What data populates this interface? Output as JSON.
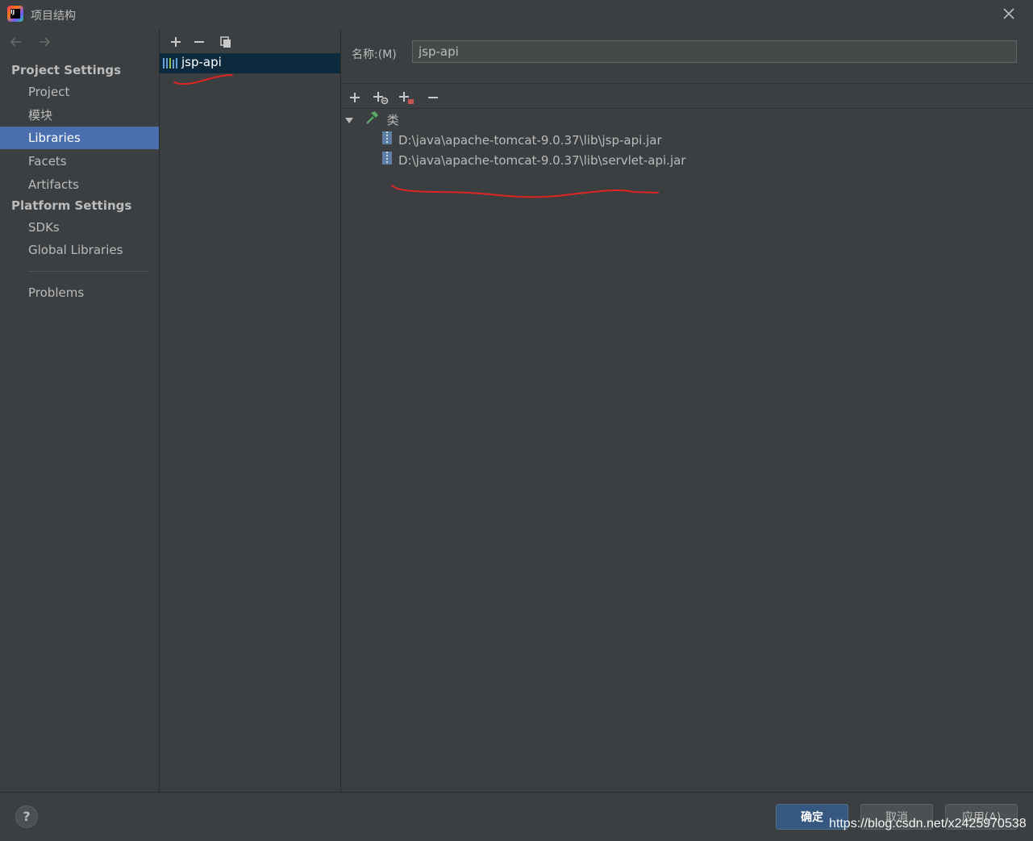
{
  "window": {
    "title": "项目结构"
  },
  "sidebar": {
    "project_settings_heading": "Project Settings",
    "platform_settings_heading": "Platform Settings",
    "items": [
      {
        "label": "Project"
      },
      {
        "label": "模块"
      },
      {
        "label": "Libraries",
        "selected": true
      },
      {
        "label": "Facets"
      },
      {
        "label": "Artifacts"
      },
      {
        "label": "SDKs"
      },
      {
        "label": "Global Libraries"
      },
      {
        "label": "Problems"
      }
    ]
  },
  "libraries": {
    "items": [
      {
        "label": "jsp-api",
        "selected": true
      }
    ]
  },
  "detail": {
    "name_label": "名称:(M)",
    "name_value": "jsp-api",
    "tree": {
      "root_label": "类",
      "jars": [
        "D:\\java\\apache-tomcat-9.0.37\\lib\\jsp-api.jar",
        "D:\\java\\apache-tomcat-9.0.37\\lib\\servlet-api.jar"
      ]
    }
  },
  "footer": {
    "help_label": "?",
    "ok_label": "确定",
    "cancel_label": "取消",
    "apply_label": "应用(A)",
    "watermark": "https://blog.csdn.net/x2425970538"
  },
  "colors": {
    "background": "#3c3f41",
    "selection": "#4b6eaf",
    "list_selection": "#0d293e",
    "primary_button": "#365880",
    "annotation": "#e02424"
  }
}
